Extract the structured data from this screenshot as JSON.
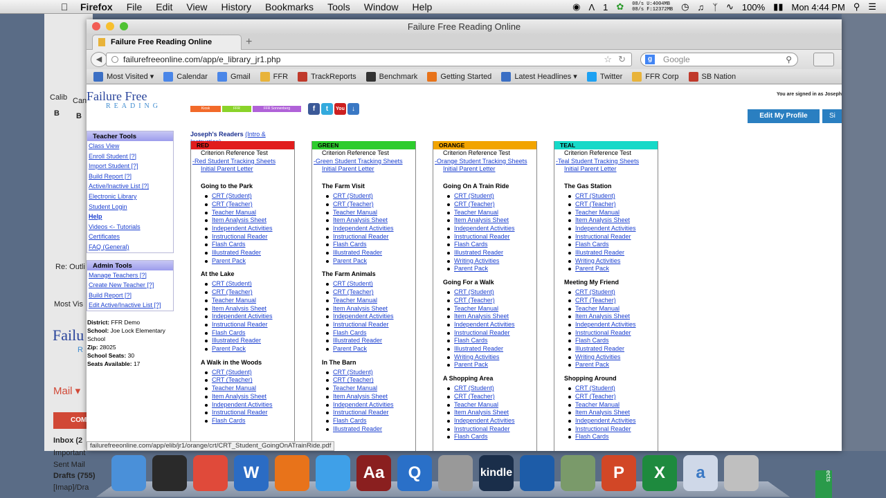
{
  "menubar": {
    "app": "Firefox",
    "items": [
      "File",
      "Edit",
      "View",
      "History",
      "Bookmarks",
      "Tools",
      "Window",
      "Help"
    ],
    "net_up": "08/s U:",
    "net_down": "08/s F:",
    "mem_used": "4004MB",
    "mem_free": "12372MB",
    "count": "1",
    "battery": "100%",
    "clock": "Mon 4:44 PM"
  },
  "window": {
    "title": "Failure Free Reading Online",
    "tab_label": "Failure Free Reading Online",
    "new_tab": "+",
    "url": "failurefreeonline.com/app/e_library_jr1.php",
    "search_placeholder": "Google"
  },
  "bookmarks": [
    {
      "label": "Most Visited ▾",
      "color": "#3b6fc4"
    },
    {
      "label": "Calendar",
      "color": "#4a86e8"
    },
    {
      "label": "Gmail",
      "color": "#4a86e8"
    },
    {
      "label": "FFR",
      "color": "#e8b33a"
    },
    {
      "label": "TrackReports",
      "color": "#c0392b"
    },
    {
      "label": "Benchmark",
      "color": "#333333"
    },
    {
      "label": "Getting Started",
      "color": "#e8731a"
    },
    {
      "label": "Latest Headlines ▾",
      "color": "#3b6fc4"
    },
    {
      "label": "Twitter",
      "color": "#1da1f2"
    },
    {
      "label": "FFR Corp",
      "color": "#e8b33a"
    },
    {
      "label": "SB Nation",
      "color": "#c0392b"
    }
  ],
  "header": {
    "logo_line1": "Failure Free",
    "logo_line2": "READING",
    "signed_in": "You are signed in as Joseph",
    "edit_profile": "Edit My Profile",
    "edit_profile_more": "Si",
    "tabs": [
      "Kiosk",
      "FFR",
      "FFR Sonnenberg"
    ]
  },
  "sidebar": {
    "teacher_title": "Teacher Tools",
    "teacher_links": [
      "Class View",
      "Enroll Student [?]",
      "Import Student [?]",
      "Build Report [?]",
      "Active/Inactive List [?]",
      "Electronic Library",
      "Student Login",
      "Help",
      "Videos <- Tutorials",
      "Certificates",
      "FAQ (General)"
    ],
    "admin_title": "Admin Tools",
    "admin_links": [
      "Manage Teachers [?]",
      "Create New Teacher [?]",
      "Build Report [?]",
      "Edit Active/Inactive List [?]"
    ],
    "district_label": "District:",
    "district": "FFR Demo",
    "school_label": "School:",
    "school": "Joe Lock Elementary School",
    "zip_label": "Zip:",
    "zip": "28025",
    "seats_label": "School Seats:",
    "seats": "30",
    "avail_label": "Seats Available:",
    "avail": "17"
  },
  "readers": {
    "title": "Joseph's Readers",
    "link": "(Intro & Instruction)"
  },
  "columns": [
    {
      "name": "RED",
      "color": "#e11d1d",
      "crt": "Criterion Reference Test",
      "tracking": "-Red Student Tracking Sheets",
      "letter": "Initial Parent Letter",
      "books": [
        {
          "title": "Going to the Park",
          "items": [
            "CRT (Student)",
            "CRT (Teacher)",
            "Teacher Manual",
            "Item Analysis Sheet",
            "Independent Activities",
            "Instructional Reader",
            "Flash Cards",
            "Illustrated Reader",
            "Parent Pack"
          ]
        },
        {
          "title": "At the Lake",
          "items": [
            "CRT (Student)",
            "CRT (Teacher)",
            "Teacher Manual",
            "Item Analysis Sheet",
            "Independent Activities",
            "Instructional Reader",
            "Flash Cards",
            "Illustrated Reader",
            "Parent Pack"
          ]
        },
        {
          "title": "A Walk in the Woods",
          "items": [
            "CRT (Student)",
            "CRT (Teacher)",
            "Teacher Manual",
            "Item Analysis Sheet",
            "Independent Activities",
            "Instructional Reader",
            "Flash Cards"
          ]
        }
      ]
    },
    {
      "name": "GREEN",
      "color": "#2dcc2d",
      "crt": "Criterion Reference Test",
      "tracking": "-Green Student Tracking Sheets",
      "letter": "Initial Parent Letter",
      "books": [
        {
          "title": "The Farm Visit",
          "items": [
            "CRT (Student)",
            "CRT (Teacher)",
            "Teacher Manual",
            "Item Analysis Sheet",
            "Independent Activities",
            "Instructional Reader",
            "Flash Cards",
            "Illustrated Reader",
            "Parent Pack"
          ]
        },
        {
          "title": "The Farm Animals",
          "items": [
            "CRT (Student)",
            "CRT (Teacher)",
            "Teacher Manual",
            "Item Analysis Sheet",
            "Independent Activities",
            "Instructional Reader",
            "Flash Cards",
            "Illustrated Reader",
            "Parent Pack"
          ]
        },
        {
          "title": "In The Barn",
          "items": [
            "CRT (Student)",
            "CRT (Teacher)",
            "Teacher Manual",
            "Item Analysis Sheet",
            "Independent Activities",
            "Instructional Reader",
            "Flash Cards",
            "Illustrated Reader"
          ]
        }
      ]
    },
    {
      "name": "ORANGE",
      "color": "#f2a400",
      "crt": "Criterion Reference Test",
      "tracking": "-Orange Student Tracking Sheets",
      "letter": "Initial Parent Letter",
      "books": [
        {
          "title": "Going On A Train Ride",
          "items": [
            "CRT (Student)",
            "CRT (Teacher)",
            "Teacher Manual",
            "Item Analysis Sheet",
            "Independent Activities",
            "Instructional Reader",
            "Flash Cards",
            "Illustrated Reader",
            "Writing Activities",
            "Parent Pack"
          ]
        },
        {
          "title": "Going For a Walk",
          "items": [
            "CRT (Student)",
            "CRT (Teacher)",
            "Teacher Manual",
            "Item Analysis Sheet",
            "Independent Activities",
            "Instructional Reader",
            "Flash Cards",
            "Illustrated Reader",
            "Writing Activities",
            "Parent Pack"
          ]
        },
        {
          "title": "A Shopping Area",
          "items": [
            "CRT (Student)",
            "CRT (Teacher)",
            "Teacher Manual",
            "Item Analysis Sheet",
            "Independent Activities",
            "Instructional Reader",
            "Flash Cards"
          ]
        }
      ]
    },
    {
      "name": "TEAL",
      "color": "#16d9c8",
      "crt": "Criterion Reference Test",
      "tracking": "-Teal Student Tracking Sheets",
      "letter": "Initial Parent Letter",
      "books": [
        {
          "title": "The Gas Station",
          "items": [
            "CRT (Student)",
            "CRT (Teacher)",
            "Teacher Manual",
            "Item Analysis Sheet",
            "Independent Activities",
            "Instructional Reader",
            "Flash Cards",
            "Illustrated Reader",
            "Writing Activities",
            "Parent Pack"
          ]
        },
        {
          "title": "Meeting My Friend",
          "items": [
            "CRT (Student)",
            "CRT (Teacher)",
            "Teacher Manual",
            "Item Analysis Sheet",
            "Independent Activities",
            "Instructional Reader",
            "Flash Cards",
            "Illustrated Reader",
            "Writing Activities",
            "Parent Pack"
          ]
        },
        {
          "title": "Shopping Around",
          "items": [
            "CRT (Student)",
            "CRT (Teacher)",
            "Teacher Manual",
            "Item Analysis Sheet",
            "Independent Activities",
            "Instructional Reader",
            "Flash Cards"
          ]
        }
      ]
    }
  ],
  "status_url": "failurefreeonline.com/app/elib/jr1/orange/crt/CRT_Student_GoingOnATrainRide.pdf",
  "background": {
    "left_items": [
      "Calib",
      "Can",
      "B",
      "B",
      "Re: Outli",
      "Most Vis",
      "Failu",
      "R",
      "Mail ▾",
      "COM",
      "Inbox (2",
      "Important",
      "Sent Mail",
      "Drafts (755)",
      "[Imap]/Dra"
    ],
    "right_items": [
      "ects"
    ]
  },
  "dock": [
    {
      "name": "finder",
      "label": "",
      "color": "#4a90d9"
    },
    {
      "name": "dashboard",
      "label": "",
      "color": "#2a2a2a"
    },
    {
      "name": "chrome",
      "label": "",
      "color": "#e04a3a"
    },
    {
      "name": "word",
      "label": "W",
      "color": "#2b6cc4"
    },
    {
      "name": "firefox",
      "label": "",
      "color": "#e8731a"
    },
    {
      "name": "safari",
      "label": "",
      "color": "#3fa0e8"
    },
    {
      "name": "dictionary",
      "label": "Aa",
      "color": "#8a1f1f"
    },
    {
      "name": "quicktime",
      "label": "Q",
      "color": "#2a70c8"
    },
    {
      "name": "calculator",
      "label": "",
      "color": "#999999"
    },
    {
      "name": "kindle",
      "label": "kindle",
      "color": "#1a2e4a"
    },
    {
      "name": "virtualbox",
      "label": "",
      "color": "#1d5ca8"
    },
    {
      "name": "preview",
      "label": "",
      "color": "#7a9a6a"
    },
    {
      "name": "powerpoint",
      "label": "P",
      "color": "#d24726"
    },
    {
      "name": "excel",
      "label": "X",
      "color": "#1e8a3e"
    },
    {
      "name": "docx",
      "label": "a",
      "color": "#cfd8e8"
    },
    {
      "name": "trash",
      "label": "",
      "color": "#bfbfbf"
    }
  ]
}
